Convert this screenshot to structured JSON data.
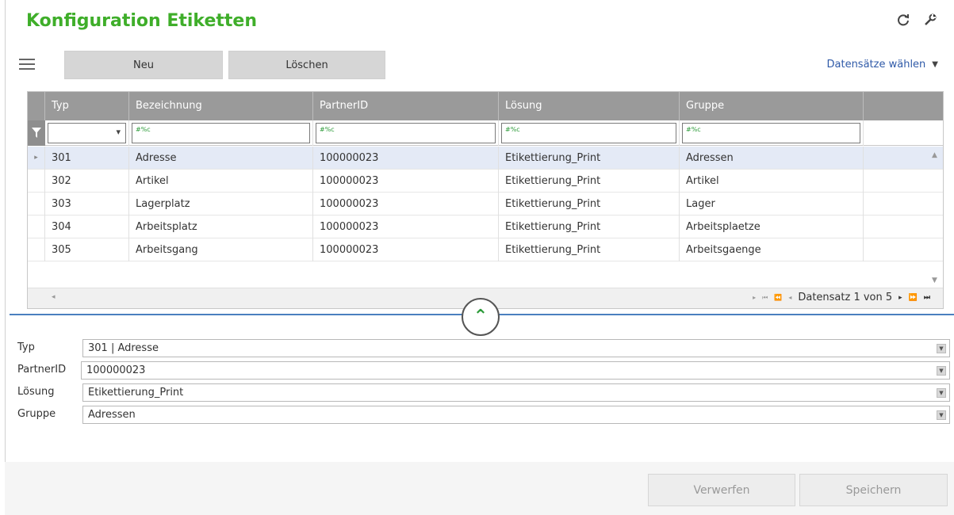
{
  "title": "Konfiguration Etiketten",
  "toolbar": {
    "new_label": "Neu",
    "delete_label": "Löschen",
    "records_select_label": "Datensätze wählen"
  },
  "grid": {
    "columns": [
      "Typ",
      "Bezeichnung",
      "PartnerID",
      "Lösung",
      "Gruppe"
    ],
    "filter_placeholder": "#%c",
    "rows": [
      [
        "301",
        "Adresse",
        "100000023",
        "Etikettierung_Print",
        "Adressen"
      ],
      [
        "302",
        "Artikel",
        "100000023",
        "Etikettierung_Print",
        "Artikel"
      ],
      [
        "303",
        "Lagerplatz",
        "100000023",
        "Etikettierung_Print",
        "Lager"
      ],
      [
        "304",
        "Arbeitsplatz",
        "100000023",
        "Etikettierung_Print",
        "Arbeitsplaetze"
      ],
      [
        "305",
        "Arbeitsgang",
        "100000023",
        "Etikettierung_Print",
        "Arbeitsgaenge"
      ]
    ],
    "pager_text": "Datensatz 1 von 5"
  },
  "form": {
    "typ_label": "Typ",
    "typ_value": "301 | Adresse",
    "partnerid_label": "PartnerID",
    "partnerid_value": "100000023",
    "loesung_label": "Lösung",
    "loesung_value": "Etikettierung_Print",
    "gruppe_label": "Gruppe",
    "gruppe_value": "Adressen"
  },
  "footer": {
    "discard_label": "Verwerfen",
    "save_label": "Speichern"
  },
  "colors": {
    "title_green": "#3fae2a",
    "header_gray": "#9a9a9a",
    "selected_row": "#e4eaf6",
    "link_blue": "#2f5aa8",
    "divider_blue": "#4a7fbf"
  }
}
